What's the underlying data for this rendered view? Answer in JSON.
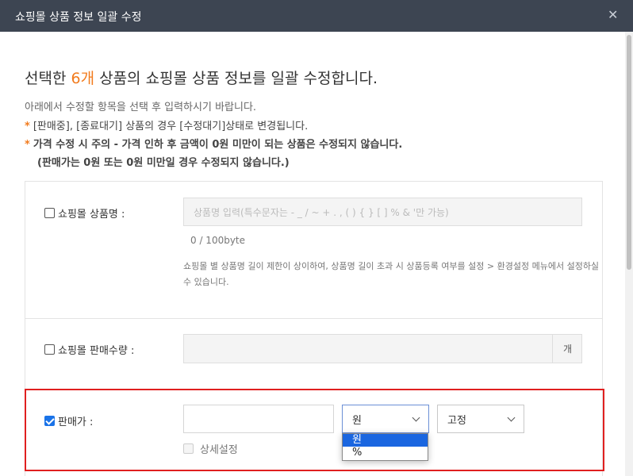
{
  "window": {
    "title": "쇼핑몰 상품 정보 일괄 수정",
    "close_icon": "close-icon"
  },
  "intro": {
    "headline_pre": "선택한 ",
    "headline_count": "6개",
    "headline_post": " 상품의 쇼핑몰 상품 정보를 일괄 수정합니다.",
    "description": "아래에서 수정할 항목을 선택 후 입력하시기 바랍니다.",
    "warning1": "[판매중], [종료대기] 상품의 경우 [수정대기]상태로 변경됩니다.",
    "warning2": "가격 수정 시 주의 - 가격 인하 후 금액이 0원 미만이 되는 상품은 수정되지 않습니다.",
    "warning3": "(판매가는 0원 또는 0원 미만일 경우 수정되지 않습니다.)",
    "star": "*"
  },
  "fields": {
    "product_name": {
      "label": "쇼핑몰 상품명 :",
      "checked": false,
      "placeholder": "상품명 입력(특수문자는 - _ / ~ + . , ( ) { } [ ] % & '만 가능)",
      "byte_count": "0 / 100byte",
      "note": "쇼핑몰 별 상품명 길이 제한이 상이하여, 상품명 길이 초과 시 상품등록 여부를 설정 > 환경설정 메뉴에서 설정하실 수 있습니다."
    },
    "sales_quantity": {
      "label": "쇼핑몰 판매수량 :",
      "checked": false,
      "value": "",
      "unit": "개"
    },
    "sale_price": {
      "label": "판매가 :",
      "checked": true,
      "value": "",
      "unit_select": "원",
      "mode_select": "고정",
      "unit_options": [
        "원",
        "%"
      ],
      "detail_label": "상세설정",
      "detail_checked": false
    }
  },
  "colors": {
    "title_bg": "#3d4552",
    "accent_orange": "#f27b1d",
    "highlight_red": "#e02020",
    "selected_blue": "#1a66e0"
  }
}
